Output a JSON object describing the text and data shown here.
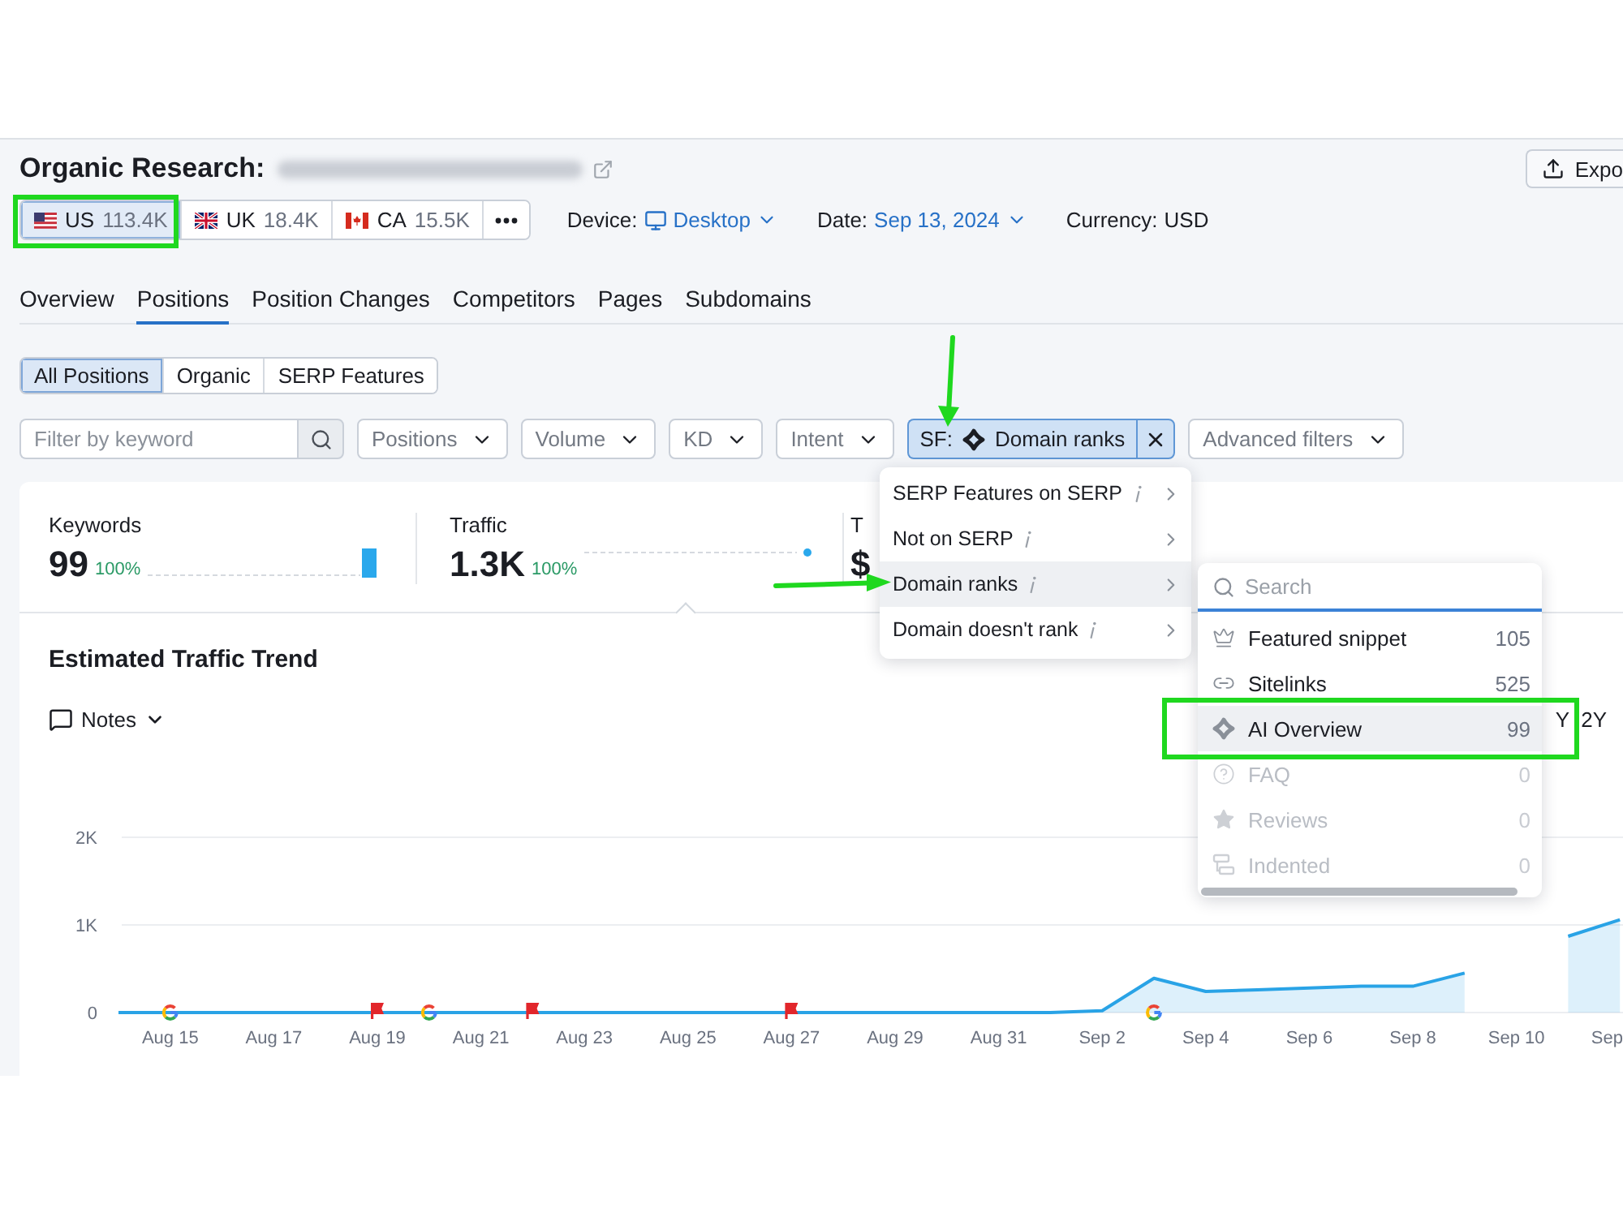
{
  "header": {
    "title": "Organic Research:",
    "export": {
      "label": "Expo"
    }
  },
  "databases": [
    {
      "kind": "us",
      "code": "US",
      "count": "113.4K",
      "selected": true
    },
    {
      "kind": "uk",
      "code": "UK",
      "count": "18.4K",
      "selected": false
    },
    {
      "kind": "ca",
      "code": "CA",
      "count": "15.5K",
      "selected": false
    }
  ],
  "settings": [
    {
      "kind": "device",
      "label": "Device:",
      "value": "Desktop"
    },
    {
      "kind": "date",
      "label": "Date:",
      "value": "Sep 13, 2024"
    },
    {
      "kind": "plain",
      "label": "Currency:",
      "value": "USD"
    }
  ],
  "tabs": [
    {
      "label": "Overview",
      "selected": false
    },
    {
      "label": "Positions",
      "selected": true
    },
    {
      "label": "Position Changes",
      "selected": false
    },
    {
      "label": "Competitors",
      "selected": false
    },
    {
      "label": "Pages",
      "selected": false
    },
    {
      "label": "Subdomains",
      "selected": false
    }
  ],
  "position_types": [
    {
      "label": "All Positions",
      "selected": true
    },
    {
      "label": "Organic",
      "selected": false
    },
    {
      "label": "SERP Features",
      "selected": false
    }
  ],
  "filters": [
    {
      "kind": "search",
      "placeholder": "Filter by keyword"
    },
    {
      "kind": "dropdown",
      "label": "Positions"
    },
    {
      "kind": "dropdown",
      "label": "Volume"
    },
    {
      "kind": "dropdown",
      "label": "KD"
    },
    {
      "kind": "dropdown",
      "label": "Intent"
    },
    {
      "kind": "chip",
      "prefix": "SF:",
      "label": "Domain ranks"
    },
    {
      "kind": "dropdown",
      "label": "Advanced filters"
    }
  ],
  "stats": [
    {
      "label": "Keywords",
      "value": "99",
      "change": "100%",
      "kind": "bar",
      "selected": false
    },
    {
      "label": "Traffic",
      "value": "1.3K",
      "change": "100%",
      "kind": "dot",
      "selected": true
    },
    {
      "label": "T",
      "value": "$",
      "selected": false
    }
  ],
  "sf_menu": {
    "items": [
      {
        "label": "SERP Features on SERP",
        "selected": false
      },
      {
        "label": "Not on SERP",
        "selected": false
      },
      {
        "label": "Domain ranks",
        "selected": true
      },
      {
        "label": "Domain doesn't rank",
        "selected": false
      }
    ]
  },
  "feature_menu": {
    "search": {
      "placeholder": "Search"
    },
    "items": [
      {
        "kind": "featured_snippet",
        "label": "Featured snippet",
        "count": "105",
        "disabled": false,
        "selected": false
      },
      {
        "kind": "sitelinks",
        "label": "Sitelinks",
        "count": "525",
        "disabled": false,
        "selected": false
      },
      {
        "kind": "ai_overview",
        "label": "AI Overview",
        "count": "99",
        "disabled": false,
        "selected": true
      },
      {
        "kind": "faq",
        "label": "FAQ",
        "count": "0",
        "disabled": true,
        "selected": false
      },
      {
        "kind": "reviews",
        "label": "Reviews",
        "count": "0",
        "disabled": true,
        "selected": false
      },
      {
        "kind": "indented",
        "label": "Indented",
        "count": "0",
        "disabled": true,
        "selected": false
      }
    ]
  },
  "trend": {
    "title": "Estimated Traffic Trend",
    "notes": {
      "label": "Notes"
    },
    "ranges": [
      {
        "label": "Y"
      },
      {
        "label": "2Y"
      }
    ],
    "chart_data": {
      "type": "area",
      "x": [
        "--08-14",
        "--08-15",
        "--08-16",
        "--08-17",
        "--08-18",
        "--08-19",
        "--08-20",
        "--08-21",
        "--08-22",
        "--08-23",
        "--08-24",
        "--08-25",
        "--08-26",
        "--08-27",
        "--08-28",
        "--08-29",
        "--08-30",
        "--08-31",
        "--09-01",
        "--09-02",
        "--09-03",
        "--09-04",
        "--09-05",
        "--09-06",
        "--09-07",
        "--09-08",
        "--09-09",
        "--09-10",
        "--09-11",
        "--09-12"
      ],
      "values": [
        0,
        0,
        0,
        0,
        0,
        0,
        0,
        0,
        0,
        0,
        0,
        0,
        0,
        0,
        0,
        0,
        0,
        0,
        0,
        20,
        390,
        240,
        260,
        280,
        300,
        300,
        450,
        null,
        870,
        1060
      ],
      "color": "#29a3e6",
      "grid": true,
      "xlim": [
        "--08-14",
        "--09-12"
      ],
      "ylim": [
        0,
        2000
      ],
      "yticks": [
        {
          "value": 0,
          "label": "0"
        },
        {
          "value": 1000,
          "label": "1K"
        },
        {
          "value": 2000,
          "label": "2K"
        }
      ],
      "xticks": [
        {
          "value": "--08-15",
          "label": "Aug 15"
        },
        {
          "value": "--08-17",
          "label": "Aug 17"
        },
        {
          "value": "--08-19",
          "label": "Aug 19"
        },
        {
          "value": "--08-21",
          "label": "Aug 21"
        },
        {
          "value": "--08-23",
          "label": "Aug 23"
        },
        {
          "value": "--08-25",
          "label": "Aug 25"
        },
        {
          "value": "--08-27",
          "label": "Aug 27"
        },
        {
          "value": "--08-29",
          "label": "Aug 29"
        },
        {
          "value": "--08-31",
          "label": "Aug 31"
        },
        {
          "value": "--09-02",
          "label": "Sep 2"
        },
        {
          "value": "--09-04",
          "label": "Sep 4"
        },
        {
          "value": "--09-06",
          "label": "Sep 6"
        },
        {
          "value": "--09-08",
          "label": "Sep 8"
        },
        {
          "value": "--09-10",
          "label": "Sep 10"
        },
        {
          "value": "--09-12",
          "label": "Sep"
        }
      ]
    }
  }
}
